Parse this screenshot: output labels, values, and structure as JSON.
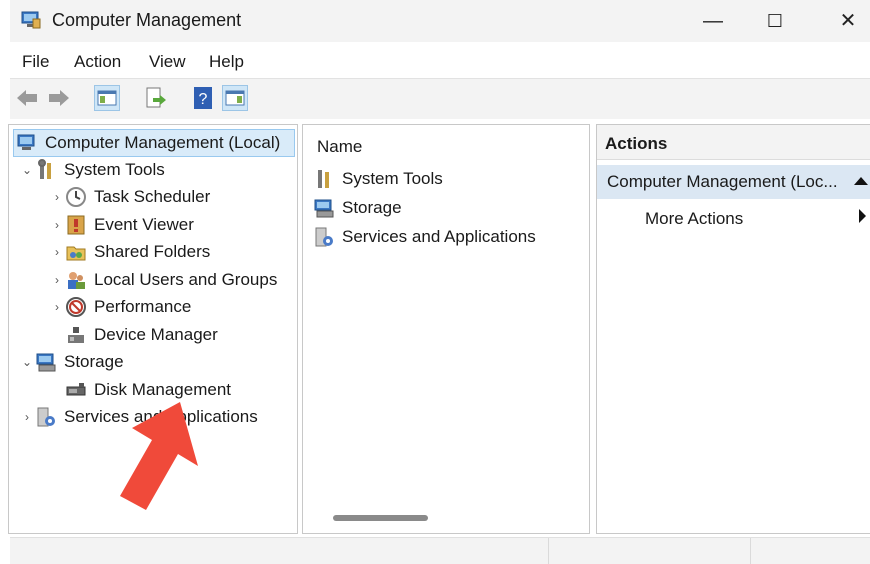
{
  "window": {
    "title": "Computer Management",
    "controls": {
      "minimize": "—",
      "maximize": "☐",
      "close": "✕"
    }
  },
  "menu": [
    "File",
    "Action",
    "View",
    "Help"
  ],
  "toolbar": {
    "buttons": [
      "back-arrow-icon",
      "forward-arrow-icon",
      "show-hide-console-tree-icon",
      "export-list-icon",
      "help-icon",
      "show-hide-action-pane-icon"
    ]
  },
  "tree": {
    "root": "Computer Management (Local)",
    "system_tools": "System Tools",
    "task_scheduler": "Task Scheduler",
    "event_viewer": "Event Viewer",
    "shared_folders": "Shared Folders",
    "local_users_groups": "Local Users and Groups",
    "performance": "Performance",
    "device_manager": "Device Manager",
    "storage": "Storage",
    "disk_management": "Disk Management",
    "services_apps": "Services and Applications"
  },
  "list": {
    "column_name": "Name",
    "items": [
      "System Tools",
      "Storage",
      "Services and Applications"
    ]
  },
  "actions": {
    "header": "Actions",
    "section": "Computer Management (Loc...",
    "more_actions": "More Actions"
  },
  "colors": {
    "arrow_annotation": "#f04a3a",
    "selection": "#d9ebf9",
    "actions_section": "#dbe7f3"
  }
}
